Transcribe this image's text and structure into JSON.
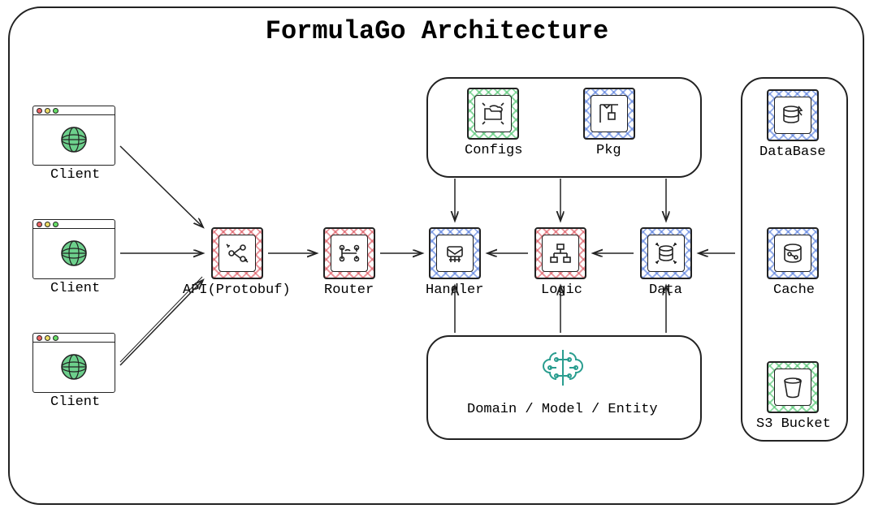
{
  "title": "FormulaGo Architecture",
  "nodes": {
    "client": "Client",
    "api": "API(Protobuf)",
    "router": "Router",
    "handler": "Handler",
    "logic": "Logic",
    "data": "Data",
    "configs": "Configs",
    "pkg": "Pkg",
    "domain": "Domain / Model / Entity",
    "database": "DataBase",
    "cache": "Cache",
    "s3": "S3 Bucket"
  }
}
